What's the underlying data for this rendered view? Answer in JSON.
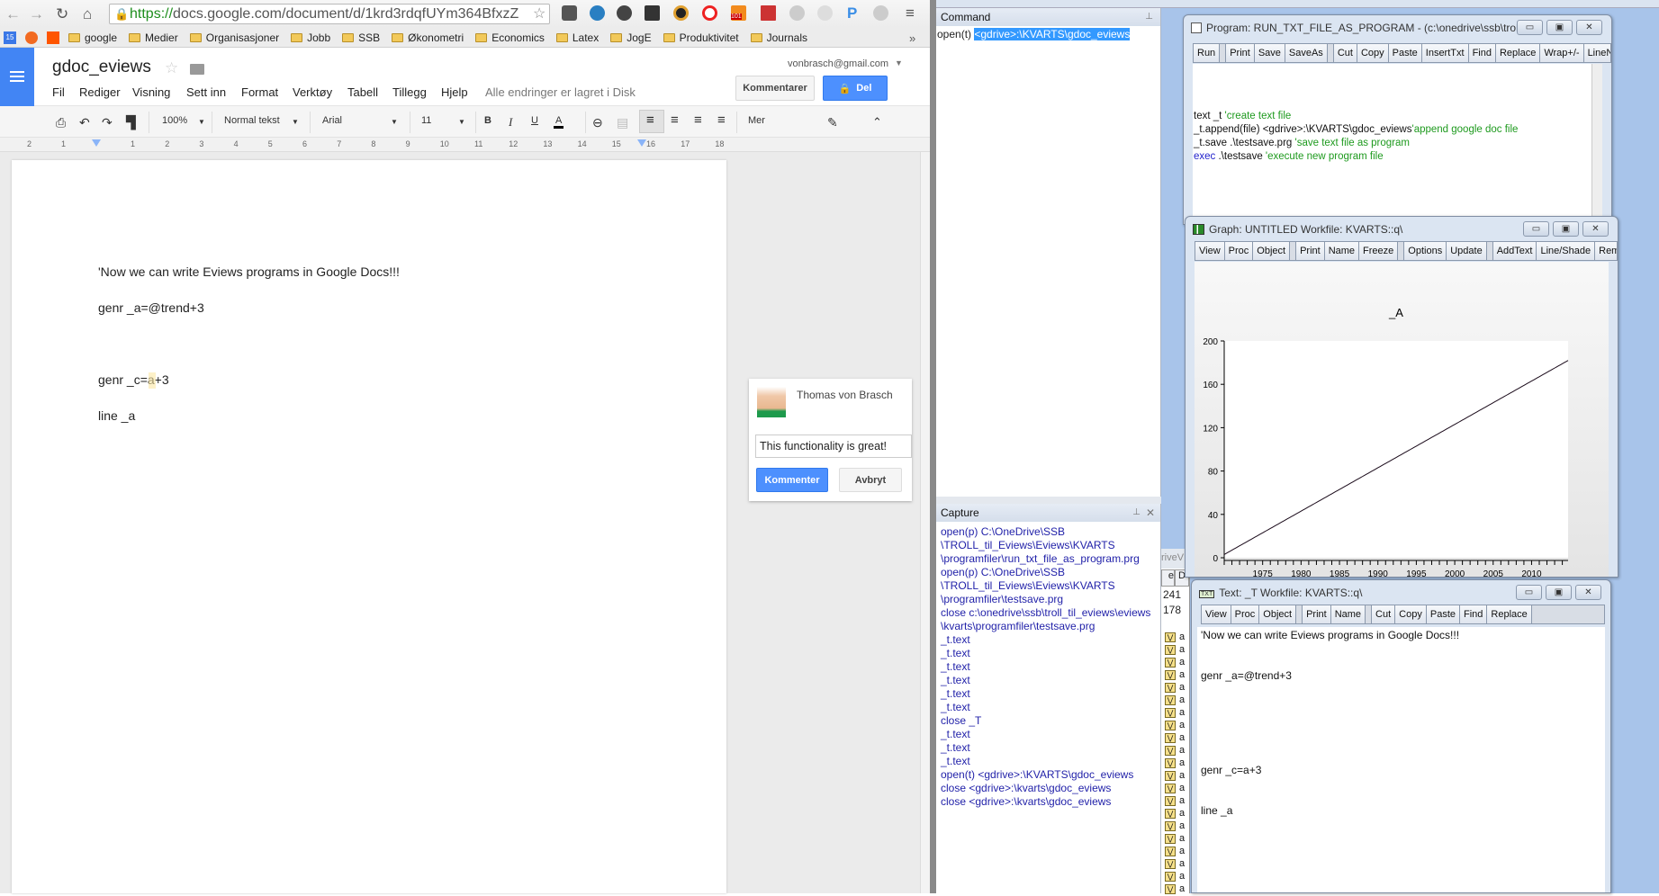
{
  "browser": {
    "url_scheme": "https://",
    "url_rest": "docs.google.com/document/d/1krd3rdqfUYm364BfxzZ",
    "bookmarks": [
      "google",
      "Medier",
      "Organisasjoner",
      "Jobb",
      "SSB",
      "Økonometri",
      "Economics",
      "Latex",
      "JogE",
      "Produktivitet",
      "Journals"
    ],
    "calendar_badge": "15",
    "overflow": "»",
    "extension_badge": "101"
  },
  "docs": {
    "title": "gdoc_eviews",
    "email": "vonbrasch@gmail.com",
    "menu": [
      "Fil",
      "Rediger",
      "Visning",
      "Sett inn",
      "Format",
      "Verktøy",
      "Tabell",
      "Tillegg",
      "Hjelp"
    ],
    "save_status": "Alle endringer er lagret i Disk",
    "comments_button": "Kommentarer",
    "share_button": "Del",
    "toolbar": {
      "zoom": "100%",
      "style": "Normal tekst",
      "font": "Arial",
      "size": "11",
      "bold": "B",
      "italic": "I",
      "underline": "U",
      "text_color": "A",
      "more": "Mer"
    },
    "ruler": [
      "2",
      "1",
      "1",
      "2",
      "3",
      "4",
      "5",
      "6",
      "7",
      "8",
      "9",
      "10",
      "11",
      "12",
      "13",
      "14",
      "15",
      "16",
      "17",
      "18"
    ],
    "body_lines": [
      "'Now we can write Eviews programs in Google Docs!!!",
      "genr _a=@trend+3",
      "genr _c=a+3",
      "line _a"
    ],
    "comment": {
      "author": "Thomas von Brasch",
      "text": "This functionality is great!",
      "submit": "Kommenter",
      "cancel": "Avbryt"
    }
  },
  "eviews": {
    "command": {
      "title": "Command",
      "prefix": "open(t) ",
      "selected": "<gdrive>:\\KVARTS\\gdoc_eviews"
    },
    "capture": {
      "title": "Capture",
      "lines": [
        "open(p) C:\\OneDrive\\SSB",
        "\\TROLL_til_Eviews\\Eviews\\KVARTS",
        "\\programfiler\\run_txt_file_as_program.prg",
        "open(p) C:\\OneDrive\\SSB",
        "\\TROLL_til_Eviews\\Eviews\\KVARTS",
        "\\programfiler\\testsave.prg",
        "close c:\\onedrive\\ssb\\troll_til_eviews\\eviews",
        "\\kvarts\\programfiler\\testsave.prg",
        "_t.text",
        "_t.text",
        "_t.text",
        "_t.text",
        "_t.text",
        "_t.text",
        "close _T",
        "_t.text",
        "_t.text",
        "_t.text",
        "open(t) <gdrive>:\\KVARTS\\gdoc_eviews",
        "close <gdrive>:\\kvarts\\gdoc_eviews",
        "close <gdrive>:\\kvarts\\gdoc_eviews"
      ]
    },
    "workfile": {
      "path_fragment": "riveV",
      "col_e": "e",
      "col_d": "D",
      "values": [
        "241",
        "178"
      ],
      "row_label": "a"
    },
    "program_window": {
      "title": "Program: RUN_TXT_FILE_AS_PROGRAM - (c:\\onedrive\\ssb\\trol...",
      "buttons": [
        "Run",
        "Print",
        "Save",
        "SaveAs",
        "Cut",
        "Copy",
        "Paste",
        "InsertTxt",
        "Find",
        "Replace",
        "Wrap+/-",
        "LineNum"
      ],
      "code": [
        {
          "code": "text _t ",
          "comment": "'create text file"
        },
        {
          "code": "_t.append(file) <gdrive>:\\KVARTS\\gdoc_eviews",
          "comment": "'append google doc file"
        },
        {
          "code": "_t.save .\\testsave.prg ",
          "comment": "'save text file as program"
        },
        {
          "keyword": "exec",
          "code": " .\\testsave ",
          "comment": "'execute new program file"
        }
      ]
    },
    "graph_window": {
      "title": "Graph: UNTITLED   Workfile: KVARTS::q\\",
      "buttons": [
        "View",
        "Proc",
        "Object",
        "Print",
        "Name",
        "Freeze",
        "Options",
        "Update",
        "AddText",
        "Line/Shade",
        "Remo"
      ]
    },
    "text_window": {
      "title": "Text: _T   Workfile: KVARTS::q\\",
      "buttons": [
        "View",
        "Proc",
        "Object",
        "Print",
        "Name",
        "Cut",
        "Copy",
        "Paste",
        "Find",
        "Replace"
      ],
      "lines": [
        "'Now we can write Eviews programs in Google Docs!!!",
        "genr _a=@trend+3",
        "genr _c=a+3",
        "line _a"
      ]
    }
  },
  "chart_data": {
    "type": "line",
    "title": "_A",
    "frequency": "quarterly",
    "x_start": "1970Q1",
    "x_end": "2014Q4",
    "x_ticks": [
      "1975",
      "1980",
      "1985",
      "1990",
      "1995",
      "2000",
      "2005",
      "2010"
    ],
    "y_ticks": [
      "0",
      "40",
      "80",
      "120",
      "160",
      "200"
    ],
    "ylim": [
      0,
      200
    ],
    "grid": false,
    "series": [
      {
        "values": [
          3,
          4,
          5,
          6,
          7,
          8,
          9,
          10,
          11,
          12,
          13,
          14,
          15,
          16,
          17,
          18,
          19,
          20,
          21,
          22,
          23,
          24,
          25,
          26,
          27,
          28,
          29,
          30,
          31,
          32,
          33,
          34,
          35,
          36,
          37,
          38,
          39,
          40,
          41,
          42,
          43,
          44,
          45,
          46,
          47,
          48,
          49,
          50,
          51,
          52,
          53,
          54,
          55,
          56,
          57,
          58,
          59,
          60,
          61,
          62,
          63,
          64,
          65,
          66,
          67,
          68,
          69,
          70,
          71,
          72,
          73,
          74,
          75,
          76,
          77,
          78,
          79,
          80,
          81,
          82,
          83,
          84,
          85,
          86,
          87,
          88,
          89,
          90,
          91,
          92,
          93,
          94,
          95,
          96,
          97,
          98,
          99,
          100,
          101,
          102,
          103,
          104,
          105,
          106,
          107,
          108,
          109,
          110,
          111,
          112,
          113,
          114,
          115,
          116,
          117,
          118,
          119,
          120,
          121,
          122,
          123,
          124,
          125,
          126,
          127,
          128,
          129,
          130,
          131,
          132,
          133,
          134,
          135,
          136,
          137,
          138,
          139,
          140,
          141,
          142,
          143,
          144,
          145,
          146,
          147,
          148,
          149,
          150,
          151,
          152,
          153,
          154,
          155,
          156,
          157,
          158,
          159,
          160,
          161,
          162,
          163,
          164,
          165,
          166,
          167,
          168,
          169,
          170,
          171,
          172,
          173,
          174,
          175,
          176,
          177,
          178,
          179,
          180,
          181,
          182
        ]
      }
    ],
    "line_color": "#1a0a1a"
  },
  "colors": {
    "docs_blue": "#4285f4",
    "eviews_mdi": "#a8c4ea",
    "capture_text": "#1f1fa8",
    "comment_green": "#1e9a1e",
    "selection": "#3399ff"
  }
}
